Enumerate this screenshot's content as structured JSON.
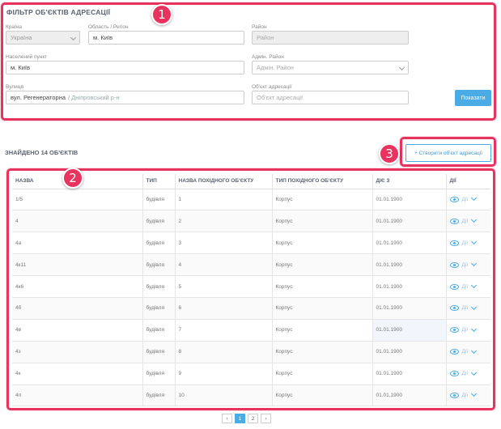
{
  "filter": {
    "title": "ФІЛЬТР ОБ'ЄКТІВ АДРЕСАЦІЇ",
    "country": {
      "label": "Країна",
      "value": "Україна"
    },
    "region": {
      "label": "Область / Регіон",
      "value": "м. Київ"
    },
    "district": {
      "label": "Район",
      "placeholder": "Район"
    },
    "settlement": {
      "label": "Населений пункт",
      "value": "м. Київ"
    },
    "admin_district": {
      "label": "Адмін. Район",
      "placeholder": "Адмін. Район"
    },
    "street": {
      "label": "Вулиця",
      "value": "вул. Регенераторна",
      "hint": "/ Дніпровський р-н"
    },
    "object": {
      "label": "Об'єкт адресації",
      "placeholder": "Об'єкт адресації"
    },
    "show_button": "Показати"
  },
  "results": {
    "found_text": "ЗНАЙДЕНО 14 ОБ'ЄКТІВ",
    "create_button": "+ Створити об'єкт адресації"
  },
  "table": {
    "headers": [
      "НАЗВА",
      "ТИП",
      "НАЗВА ПОХІДНОГО ОБ'ЄКТУ",
      "ТИП ПОХІДНОГО ОБ'ЄКТУ",
      "ДІЄ З",
      "ДІЇ"
    ],
    "action_label": "Дії",
    "rows": [
      {
        "name": "1/5",
        "type": "будівля",
        "parent_name": "1",
        "parent_type": "Корпус",
        "valid_from": "01.01.1900"
      },
      {
        "name": "4",
        "type": "будівля",
        "parent_name": "2",
        "parent_type": "Корпус",
        "valid_from": "01.01.1900"
      },
      {
        "name": "4а",
        "type": "будівля",
        "parent_name": "3",
        "parent_type": "Корпус",
        "valid_from": "01.01.1900"
      },
      {
        "name": "4к11",
        "type": "будівля",
        "parent_name": "4",
        "parent_type": "Корпус",
        "valid_from": "01.01.1900"
      },
      {
        "name": "4к6",
        "type": "будівля",
        "parent_name": "5",
        "parent_type": "Корпус",
        "valid_from": "01.01.1900"
      },
      {
        "name": "4б",
        "type": "будівля",
        "parent_name": "6",
        "parent_type": "Корпус",
        "valid_from": "01.01.1900"
      },
      {
        "name": "4в",
        "type": "будівля",
        "parent_name": "7",
        "parent_type": "Корпус",
        "valid_from": "01.01.1900"
      },
      {
        "name": "4з",
        "type": "будівля",
        "parent_name": "8",
        "parent_type": "Корпус",
        "valid_from": "01.01.1900"
      },
      {
        "name": "4к",
        "type": "будівля",
        "parent_name": "9",
        "parent_type": "Корпус",
        "valid_from": "01.01.1900"
      },
      {
        "name": "4п",
        "type": "будівля",
        "parent_name": "10",
        "parent_type": "Корпус",
        "valid_from": "01.01.1900"
      }
    ]
  },
  "pagination": {
    "prev": "‹",
    "pages": [
      "1",
      "2"
    ],
    "next": "›",
    "active": "1"
  },
  "annotations": [
    "1",
    "2",
    "3"
  ],
  "colors": {
    "highlight": "#e8335f",
    "accent": "#4aabe5"
  }
}
